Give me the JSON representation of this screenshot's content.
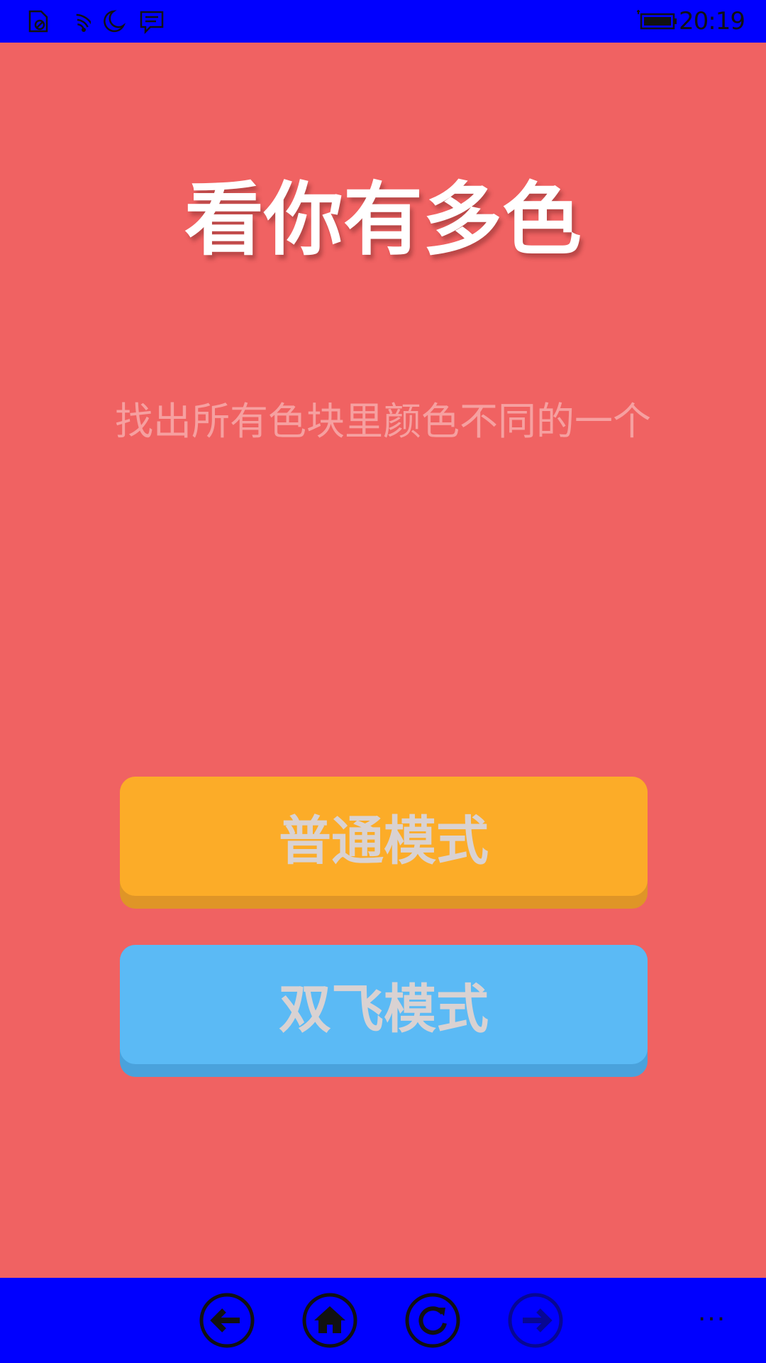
{
  "status_bar": {
    "time": "20:19",
    "icons": [
      "no-sim-icon",
      "wifi-icon",
      "quiet-hours-moon-icon",
      "message-icon",
      "battery-charging-icon"
    ]
  },
  "app": {
    "title": "看你有多色",
    "subtitle": "找出所有色块里颜色不同的一个"
  },
  "buttons": {
    "normal_mode": "普通模式",
    "double_mode": "双飞模式"
  },
  "nav_bar": {
    "icons": [
      "back-arrow-icon",
      "home-icon",
      "refresh-icon",
      "forward-arrow-icon"
    ],
    "more": "···"
  },
  "colors": {
    "background": "#f06262",
    "system_bars": "#0000ff",
    "normal_button": "#fcac28",
    "double_button": "#5bbaf5"
  }
}
